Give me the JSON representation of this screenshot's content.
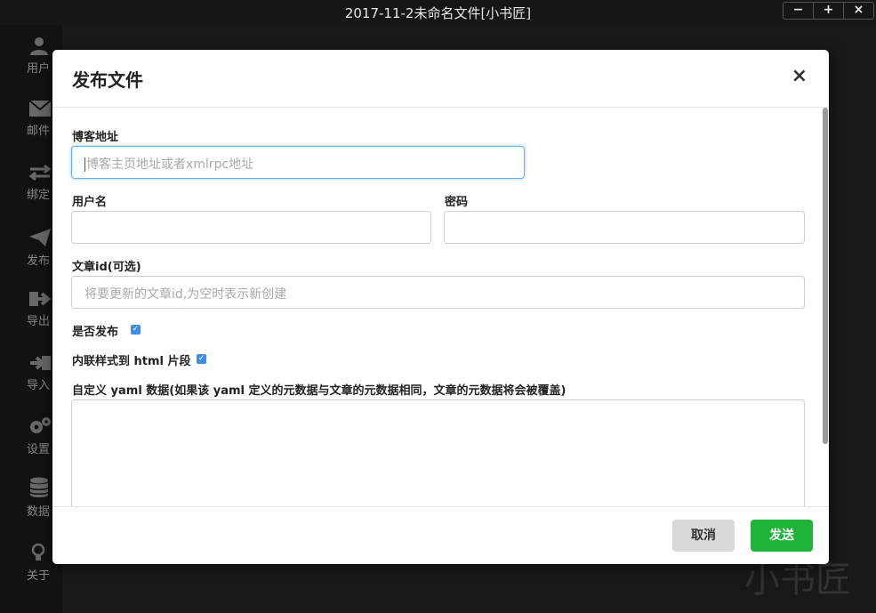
{
  "window": {
    "title": "2017-11-2未命名文件[小书匠]",
    "controls": [
      "−",
      "+",
      "×"
    ]
  },
  "sidebar": {
    "items": [
      {
        "label": "用户",
        "icon": "user-icon"
      },
      {
        "label": "邮件",
        "icon": "envelope-icon"
      },
      {
        "label": "绑定",
        "icon": "exchange-icon"
      },
      {
        "label": "发布",
        "icon": "paper-plane-icon"
      },
      {
        "label": "导出",
        "icon": "sign-out-icon"
      },
      {
        "label": "导入",
        "icon": "sign-in-icon"
      },
      {
        "label": "设置",
        "icon": "gears-icon"
      },
      {
        "label": "数据",
        "icon": "database-icon"
      },
      {
        "label": "关于",
        "icon": "lightbulb-icon"
      }
    ]
  },
  "watermark": "小书匠",
  "modal": {
    "title": "发布文件",
    "close": "×",
    "blog_url": {
      "label": "博客地址",
      "placeholder": "博客主页地址或者xmlrpc地址"
    },
    "username": {
      "label": "用户名",
      "value": ""
    },
    "password": {
      "label": "密码",
      "value": ""
    },
    "article_id": {
      "label": "文章id(可选)",
      "placeholder": "将要更新的文章id,为空时表示新创建"
    },
    "publish": {
      "label": "是否发布",
      "checked": true
    },
    "inline_style": {
      "label": "内联样式到 html 片段",
      "checked": true
    },
    "yaml": {
      "label": "自定义 yaml 数据(如果该 yaml 定义的元数据与文章的元数据相同，文章的元数据将会被覆盖)",
      "value": ""
    },
    "cancel_label": "取消",
    "send_label": "发送"
  },
  "colors": {
    "send": "#1fb33a",
    "checkbox": "#3d8ee8",
    "focus_border": "#66afe9"
  }
}
